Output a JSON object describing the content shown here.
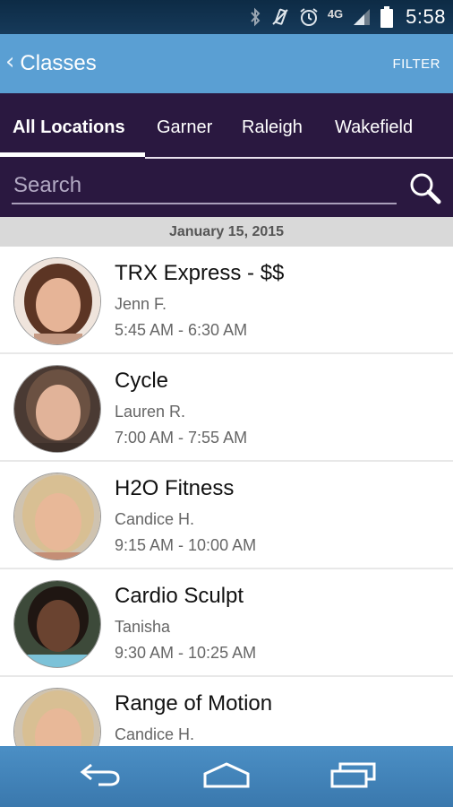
{
  "status_bar": {
    "time": "5:58",
    "network": "4G",
    "icons": [
      "bluetooth-icon",
      "vibrate-off-icon",
      "alarm-icon",
      "network-4g-icon",
      "signal-icon",
      "battery-icon"
    ]
  },
  "app_bar": {
    "back_label": "Classes",
    "filter_label": "FILTER"
  },
  "tabs": [
    {
      "label": "All Locations",
      "active": true
    },
    {
      "label": "Garner",
      "active": false
    },
    {
      "label": "Raleigh",
      "active": false
    },
    {
      "label": "Wakefield",
      "active": false
    }
  ],
  "search": {
    "placeholder": "Search",
    "value": ""
  },
  "date_header": "January 15, 2015",
  "classes": [
    {
      "name": "TRX Express - $$",
      "instructor": "Jenn F.",
      "time": "5:45 AM - 6:30 AM"
    },
    {
      "name": "Cycle",
      "instructor": "Lauren R.",
      "time": "7:00 AM - 7:55 AM"
    },
    {
      "name": "H2O Fitness",
      "instructor": "Candice H.",
      "time": "9:15 AM - 10:00 AM"
    },
    {
      "name": "Cardio Sculpt",
      "instructor": "Tanisha",
      "time": "9:30 AM - 10:25 AM"
    },
    {
      "name": "Range of Motion",
      "instructor": "Candice H.",
      "time": ""
    }
  ],
  "colors": {
    "app_bar": "#5a9fd3",
    "tab_bar": "#2a1840",
    "date_header_bg": "#d9d9d9",
    "nav_bar": "#3a78ad"
  },
  "nav_bar": {
    "icons": [
      "back-nav-icon",
      "home-nav-icon",
      "recent-apps-icon"
    ]
  }
}
